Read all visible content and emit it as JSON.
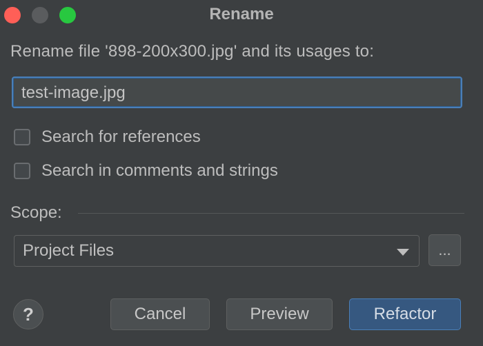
{
  "window": {
    "title": "Rename"
  },
  "dialog": {
    "prompt": "Rename file '898-200x300.jpg' and its usages to:",
    "new_name_value": "test-image.jpg",
    "options": [
      {
        "label": "Search for references",
        "checked": false
      },
      {
        "label": "Search in comments and strings",
        "checked": false
      }
    ],
    "scope_label": "Scope:",
    "scope_value": "Project Files",
    "more_label": "...",
    "help_label": "?"
  },
  "buttons": {
    "cancel": "Cancel",
    "preview": "Preview",
    "refactor": "Refactor"
  },
  "colors": {
    "background": "#3c3f41",
    "accent": "#365880",
    "focus_border": "#4a7fb8",
    "close": "#ff5f57",
    "minimize": "#5a5c5e",
    "maximize": "#28c840"
  },
  "icons": {
    "help": "question-mark-icon",
    "dropdown": "chevron-down-icon"
  }
}
